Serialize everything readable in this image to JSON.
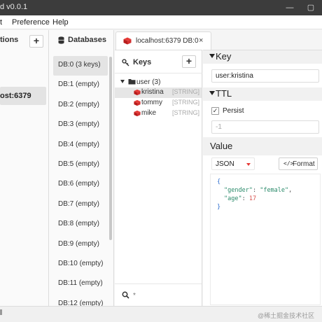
{
  "window": {
    "title": "d v0.0.1",
    "controls": {
      "minimize": "—",
      "restore": "▢"
    }
  },
  "menu": {
    "items": [
      "t",
      "Preference",
      "Help"
    ]
  },
  "connections": {
    "header": "tions",
    "add_label": "+",
    "items": [
      {
        "label": "ost:6379",
        "selected": true
      }
    ]
  },
  "databases": {
    "header": "Databases",
    "items": [
      {
        "label": "DB:0 (3 keys)",
        "selected": true
      },
      {
        "label": "DB:1 (empty)"
      },
      {
        "label": "DB:2 (empty)"
      },
      {
        "label": "DB:3 (empty)"
      },
      {
        "label": "DB:4 (empty)"
      },
      {
        "label": "DB:5 (empty)"
      },
      {
        "label": "DB:6 (empty)"
      },
      {
        "label": "DB:7 (empty)"
      },
      {
        "label": "DB:8 (empty)"
      },
      {
        "label": "DB:9 (empty)"
      },
      {
        "label": "DB:10 (empty)"
      },
      {
        "label": "DB:11 (empty)"
      },
      {
        "label": "DB:12 (empty)"
      }
    ]
  },
  "tab": {
    "label": "localhost:6379 DB:0",
    "close": "×"
  },
  "keys": {
    "header": "Keys",
    "add_label": "+",
    "folder": {
      "name": "user (3)",
      "expanded": true
    },
    "items": [
      {
        "name": "kristina",
        "type": "[STRING]",
        "selected": true
      },
      {
        "name": "tommy",
        "type": "[STRING]"
      },
      {
        "name": "mike",
        "type": "[STRING]"
      }
    ],
    "search_placeholder": "*"
  },
  "detail": {
    "key_title": "Key",
    "key_value": "user:kristina",
    "ttl_title": "TTL",
    "persist_label": "Persist",
    "persist_checked": true,
    "ttl_value": "-1",
    "value_title": "Value",
    "format_select": "JSON",
    "format_button": "Format",
    "format_icon": "</>",
    "json": {
      "open": "{",
      "close": "}",
      "gender_key": "\"gender\"",
      "gender_val": "\"female\"",
      "age_key": "\"age\"",
      "age_val": "17"
    }
  },
  "watermark": "@稀土掘金技术社区",
  "colors": {
    "accent_red": "#e53935",
    "titlebar": "#3c3c3c",
    "selected_bg": "#e4e4e4"
  }
}
